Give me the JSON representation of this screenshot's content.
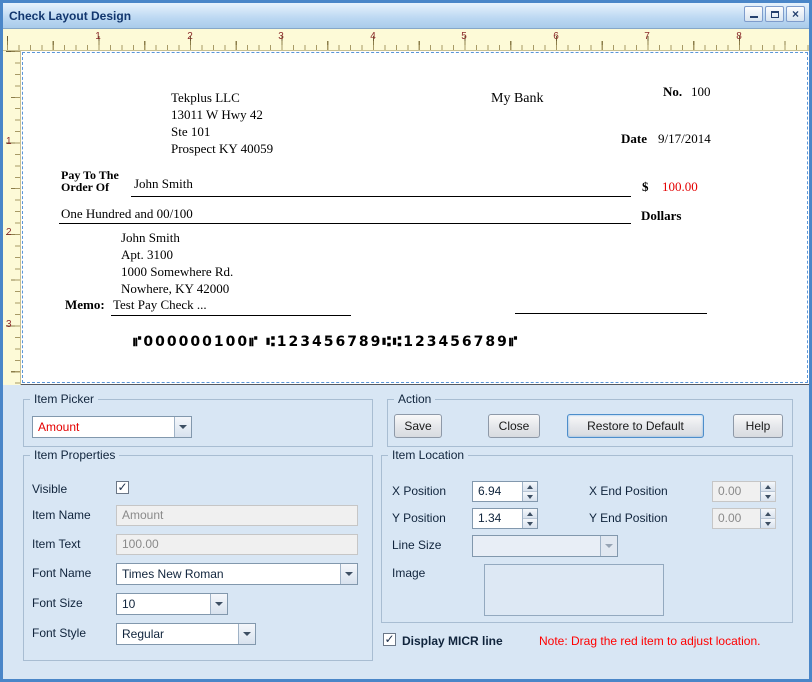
{
  "window": {
    "title": "Check Layout Design"
  },
  "icons": {
    "close": "×",
    "check": "✓"
  },
  "ruler": {
    "h": [
      "1",
      "2",
      "3",
      "4",
      "5",
      "6",
      "7",
      "8"
    ],
    "v": [
      "1",
      "2",
      "3"
    ]
  },
  "check": {
    "company": [
      "Tekplus LLC",
      "13011 W Hwy 42",
      "Ste 101",
      "Prospect KY 40059"
    ],
    "bank_name": "My Bank",
    "no_label": "No.",
    "no_value": "100",
    "date_label": "Date",
    "date_value": "9/17/2014",
    "pay_to_line1": "Pay To The",
    "pay_to_line2": "Order Of",
    "payee": "John Smith",
    "dollar_sign": "$",
    "amount": "100.00",
    "amount_words": "One Hundred and 00/100",
    "dollars_label": "Dollars",
    "address": [
      "John Smith",
      "Apt. 3100",
      "1000 Somewhere Rd.",
      "Nowhere, KY 42000"
    ],
    "memo_label": "Memo:",
    "memo_value": "Test Pay Check ...",
    "micr": "⑈000000100⑈ ⑆123456789⑆⑆123456789⑈"
  },
  "panel": {
    "item_picker": {
      "label": "Item Picker",
      "value": "Amount"
    },
    "action": {
      "label": "Action",
      "save": "Save",
      "close": "Close",
      "restore": "Restore to Default",
      "help": "Help"
    },
    "item_properties": {
      "label": "Item Properties",
      "visible_label": "Visible",
      "item_name_label": "Item Name",
      "item_name_value": "Amount",
      "item_text_label": "Item Text",
      "item_text_value": "100.00",
      "font_name_label": "Font Name",
      "font_name_value": "Times New Roman",
      "font_size_label": "Font Size",
      "font_size_value": "10",
      "font_style_label": "Font Style",
      "font_style_value": "Regular"
    },
    "item_location": {
      "label": "Item Location",
      "x_label": "X Position",
      "x_value": "6.94",
      "x_end_label": "X End Position",
      "x_end_value": "0.00",
      "y_label": "Y Position",
      "y_value": "1.34",
      "y_end_label": "Y End Position",
      "y_end_value": "0.00",
      "line_size_label": "Line Size",
      "image_label": "Image"
    },
    "micr_checkbox_label": "Display MICR line",
    "note": "Note:  Drag the red item to adjust location."
  },
  "colors": {
    "item_highlight_red": "#e40000",
    "note_red": "#ff0000",
    "panel_blue": "#d8e6f4",
    "window_border_blue": "#4a86c8",
    "ruler_cream": "#fdfad7"
  }
}
